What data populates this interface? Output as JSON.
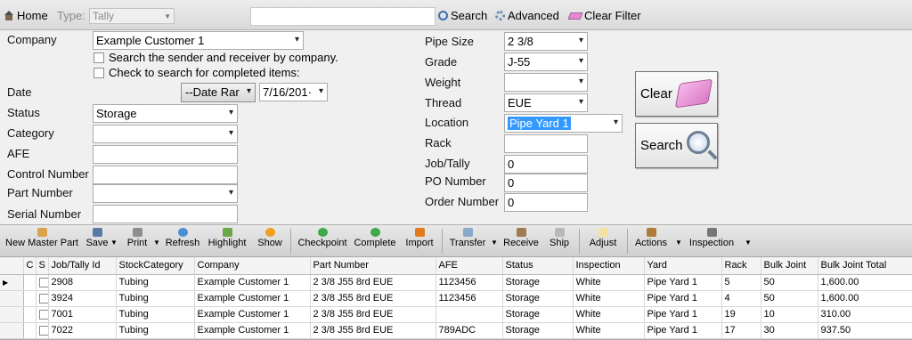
{
  "topbar": {
    "home_label": "Home",
    "type_label": "Type:",
    "type_value": "Tally",
    "search_value": "",
    "search_label": "Search",
    "advanced_label": "Advanced",
    "clear_filter_label": "Clear Filter"
  },
  "form": {
    "company_label": "Company",
    "company_value": "Example Customer 1",
    "chk_sender": "Search the sender and receiver by company.",
    "chk_completed": "Check to search for completed items:",
    "date_label": "Date",
    "date_range_value": "--Date Rar",
    "date_value": "7/16/201·",
    "status_label": "Status",
    "status_value": "Storage",
    "category_label": "Category",
    "category_value": "",
    "afe_label": "AFE",
    "afe_value": "",
    "control_number_label": "Control Number",
    "control_number_value": "",
    "part_number_label": "Part Number",
    "part_number_value": "",
    "serial_number_label": "Serial Number",
    "serial_number_value": "",
    "pipe_size_label": "Pipe Size",
    "pipe_size_value": "2 3/8",
    "grade_label": "Grade",
    "grade_value": "J-55",
    "weight_label": "Weight",
    "weight_value": "",
    "thread_label": "Thread",
    "thread_value": "EUE",
    "location_label": "Location",
    "location_value": "Pipe Yard 1",
    "rack_label": "Rack",
    "rack_value": "",
    "job_tally_label": "Job/Tally",
    "job_tally_value": "0",
    "po_number_label": "PO Number",
    "po_number_value": "0",
    "order_number_label": "Order Number",
    "order_number_value": "0",
    "clear_button": "Clear",
    "search_button": "Search"
  },
  "toolbar": {
    "new_master_part": "New Master Part",
    "save": "Save",
    "print": "Print",
    "refresh": "Refresh",
    "highlight": "Highlight",
    "show": "Show",
    "checkpoint": "Checkpoint",
    "complete": "Complete",
    "import": "Import",
    "transfer": "Transfer",
    "receive": "Receive",
    "ship": "Ship",
    "adjust": "Adjust",
    "actions": "Actions",
    "inspection": "Inspection"
  },
  "grid": {
    "columns": [
      "C",
      "S",
      "Job/Tally Id",
      "StockCategory",
      "Company",
      "Part Number",
      "AFE",
      "Status",
      "Inspection",
      "Yard",
      "Rack",
      "Bulk Joint",
      "Bulk Joint Total"
    ],
    "rows": [
      [
        "2908",
        "Tubing",
        "Example Customer 1",
        "2 3/8 J55 8rd EUE",
        "1123456",
        "Storage",
        "White",
        "Pipe Yard 1",
        "5",
        "50",
        "1,600.00"
      ],
      [
        "3924",
        "Tubing",
        "Example Customer 1",
        "2 3/8 J55 8rd EUE",
        "1123456",
        "Storage",
        "White",
        "Pipe Yard 1",
        "4",
        "50",
        "1,600.00"
      ],
      [
        "7001",
        "Tubing",
        "Example Customer 1",
        "2 3/8 J55 8rd EUE",
        "",
        "Storage",
        "White",
        "Pipe Yard 1",
        "19",
        "10",
        "310.00"
      ],
      [
        "7022",
        "Tubing",
        "Example Customer 1",
        "2 3/8 J55 8rd EUE",
        "789ADC",
        "Storage",
        "White",
        "Pipe Yard 1",
        "17",
        "30",
        "937.50"
      ]
    ]
  },
  "colors": {
    "selection": "#3399ff",
    "eraser": "#e58ad0"
  }
}
